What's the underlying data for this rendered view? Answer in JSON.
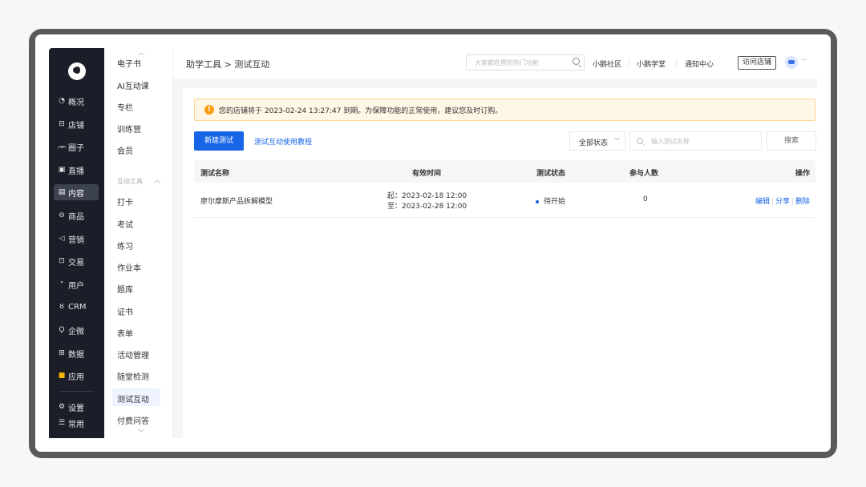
{
  "sidebar": {
    "items": [
      {
        "label": "概况",
        "icon": "pie-chart-icon"
      },
      {
        "label": "店铺",
        "icon": "store-icon"
      },
      {
        "label": "圈子",
        "icon": "group-icon"
      },
      {
        "label": "直播",
        "icon": "live-icon"
      },
      {
        "label": "内容",
        "icon": "content-icon",
        "active": true
      },
      {
        "label": "商品",
        "icon": "goods-icon"
      },
      {
        "label": "营销",
        "icon": "megaphone-icon"
      },
      {
        "label": "交易",
        "icon": "trade-icon"
      },
      {
        "label": "用户",
        "icon": "user-icon"
      },
      {
        "label": "CRM",
        "icon": "crm-icon"
      },
      {
        "label": "企微",
        "icon": "wecom-icon"
      },
      {
        "label": "数据",
        "icon": "data-icon"
      },
      {
        "label": "应用",
        "icon": "apps-icon"
      },
      {
        "label": "设置",
        "icon": "gear-icon"
      },
      {
        "label": "常用",
        "icon": "menu-icon"
      }
    ]
  },
  "subnav": {
    "items_top": [
      "电子书",
      "AI互动课",
      "专栏",
      "训练营",
      "会员"
    ],
    "group_label": "互动工具",
    "items_group": [
      "打卡",
      "考试",
      "练习",
      "作业本",
      "题库",
      "证书",
      "表单",
      "活动管理",
      "随堂检测",
      "测试互动",
      "付费问答"
    ],
    "active": "测试互动"
  },
  "topbar": {
    "breadcrumb": "助学工具 > 测试互动",
    "search_placeholder": "大家都在用的热门功能",
    "links": [
      "小鹅社区",
      "小鹅学堂",
      "通知中心"
    ],
    "visit_store": "访问店铺"
  },
  "notice": {
    "text": "您的店铺将于 2023-02-24 13:27:47 到期。为保障功能的正常使用，建议您及时订购。"
  },
  "toolbar": {
    "new_button": "新建测试",
    "tutorial_link": "测试互动使用教程",
    "status_select": "全部状态",
    "name_placeholder": "输入测试名称",
    "search_button": "搜索"
  },
  "table": {
    "headers": [
      "测试名称",
      "有效时间",
      "测试状态",
      "参与人数",
      "操作"
    ],
    "rows": [
      {
        "name": "廖尔摩斯产品拆解模型",
        "start": "起：2023-02-18 12:00",
        "end": "至：2023-02-28 12:00",
        "status": "待开始",
        "participants": "0",
        "actions": [
          "编辑",
          "分享",
          "删除"
        ]
      }
    ]
  },
  "colors": {
    "primary": "#1766e8",
    "sidebar_bg": "#1b1e29",
    "warning": "#fa9d16"
  }
}
